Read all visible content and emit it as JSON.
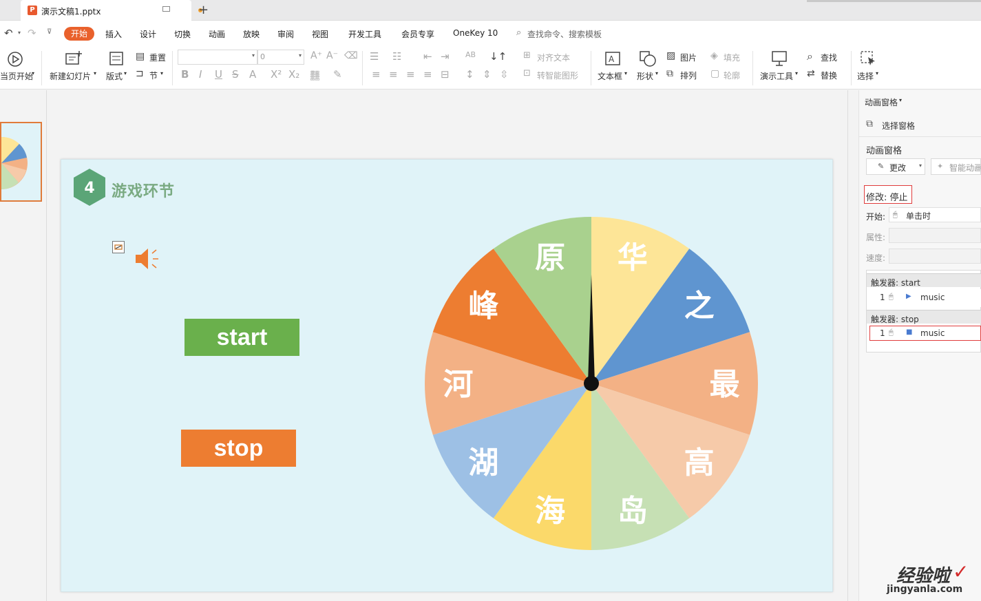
{
  "tabbar": {
    "doc_title": "演示文稿1.pptx",
    "new_tab": "+"
  },
  "menu": {
    "items": [
      "开始",
      "插入",
      "设计",
      "切换",
      "动画",
      "放映",
      "审阅",
      "视图",
      "开发工具",
      "会员专享",
      "OneKey 10"
    ],
    "search_placeholder": "查找命令、搜索模板"
  },
  "ribbon": {
    "from_start": "当页开始",
    "new_slide": "新建幻灯片",
    "layout": "版式",
    "reset": "重置",
    "section": "节",
    "font_name": "",
    "font_size": "0",
    "text_box": "文本框",
    "shape": "形状",
    "picture": "图片",
    "arrange": "排列",
    "fill": "填充",
    "outline": "轮廓",
    "align_text": "对齐文本",
    "smart_art": "转智能图形",
    "present_tools": "演示工具",
    "find": "查找",
    "replace": "替换",
    "select": "选择"
  },
  "slide": {
    "section_number": "4",
    "section_title": "游戏环节",
    "start_label": "start",
    "stop_label": "stop",
    "wheel_segments": [
      {
        "char": "华",
        "color": "#fde597"
      },
      {
        "char": "之",
        "color": "#5f95d0"
      },
      {
        "char": "最",
        "color": "#f3b185"
      },
      {
        "char": "高",
        "color": "#f6caa9"
      },
      {
        "char": "岛",
        "color": "#c6e0b4"
      },
      {
        "char": "海",
        "color": "#fbd96a"
      },
      {
        "char": "湖",
        "color": "#9dc0e5"
      },
      {
        "char": "河",
        "color": "#f3b185"
      },
      {
        "char": "峰",
        "color": "#ed7d31"
      },
      {
        "char": "原",
        "color": "#a9d18e"
      }
    ]
  },
  "right_panel": {
    "header": "动画窗格",
    "select_pane": "选择窗格",
    "section_label": "动画窗格",
    "change_button": "更改",
    "smart_anim": "智能动画",
    "modify_label": "修改: 停止",
    "start_label": "开始:",
    "start_value": "单击时",
    "property_label": "属性:",
    "speed_label": "速度:",
    "triggers": [
      {
        "header": "触发器: start",
        "index": "1",
        "name": "music"
      },
      {
        "header": "触发器: stop",
        "index": "1",
        "name": "music"
      }
    ]
  },
  "watermark": {
    "line1": "经验啦",
    "line2": "jingyanla.com"
  }
}
